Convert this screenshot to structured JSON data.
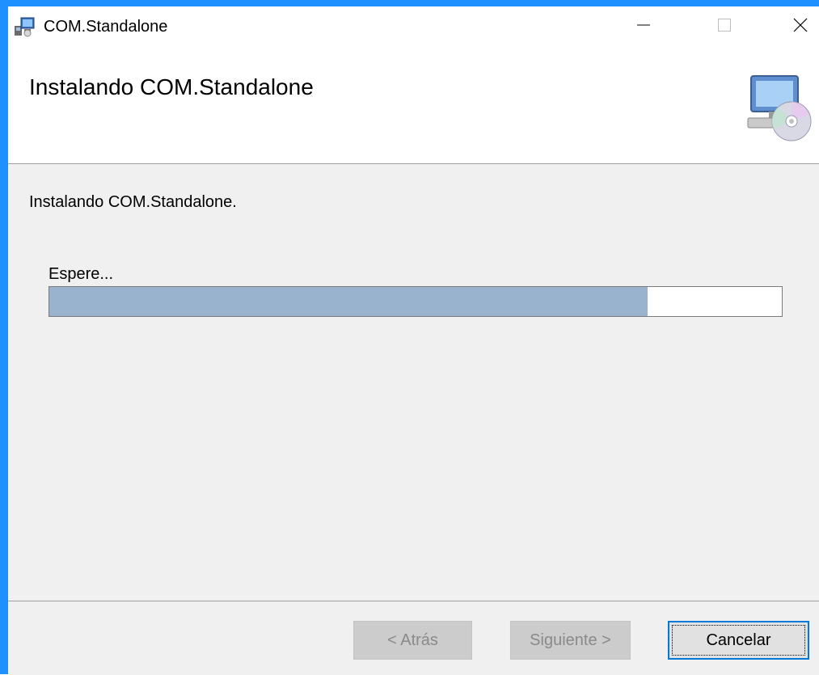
{
  "window": {
    "title": "COM.Standalone",
    "accent_color": "#1e90ff",
    "controls": {
      "minimize_icon": "minimize-icon",
      "maximize_icon": "maximize-icon",
      "close_icon": "close-icon"
    }
  },
  "header": {
    "title": "Instalando COM.Standalone",
    "icon": "installer-computer-disc-icon"
  },
  "content": {
    "status": "Instalando COM.Standalone.",
    "wait_label": "Espere...",
    "progress_fraction": 0.817,
    "progress_color": "#99b3cf"
  },
  "footer": {
    "back_label": "< Atrás",
    "next_label": "Siguiente >",
    "cancel_label": "Cancelar"
  }
}
